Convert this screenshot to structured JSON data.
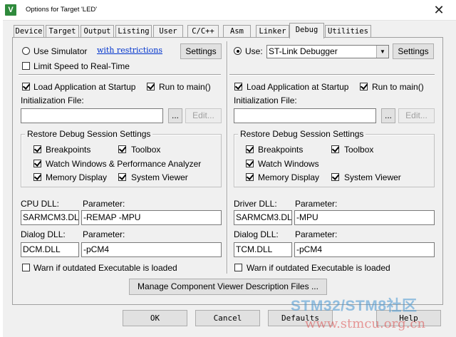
{
  "window": {
    "title": "Options for Target 'LED'",
    "icon": "V",
    "close_glyph": "✕"
  },
  "tabs": [
    {
      "label": "Device"
    },
    {
      "label": "Target"
    },
    {
      "label": "Output"
    },
    {
      "label": "Listing"
    },
    {
      "label": "User"
    },
    {
      "label": "C/C++"
    },
    {
      "label": "Asm"
    },
    {
      "label": "Linker"
    },
    {
      "label": "Debug",
      "active": true
    },
    {
      "label": "Utilities"
    }
  ],
  "left": {
    "use_simulator": "Use Simulator",
    "with_restrictions": "with restrictions",
    "settings": "Settings",
    "limit_speed": "Limit Speed to Real-Time",
    "load_app": "Load Application at Startup",
    "run_to_main": "Run to main()",
    "init_file_label": "Initialization File:",
    "browse": "...",
    "edit": "Edit...",
    "restore_title": "Restore Debug Session Settings",
    "breakpoints": "Breakpoints",
    "toolbox": "Toolbox",
    "watch": "Watch Windows & Performance Analyzer",
    "memory": "Memory Display",
    "system_viewer": "System Viewer",
    "cpu_dll_label": "CPU DLL:",
    "cpu_dll": "SARMCM3.DLL",
    "param_label": "Parameter:",
    "cpu_param": "-REMAP -MPU",
    "dialog_dll_label": "Dialog DLL:",
    "dialog_dll": "DCM.DLL",
    "dialog_param": "-pCM4",
    "warn": "Warn if outdated Executable is loaded"
  },
  "right": {
    "use": "Use:",
    "debugger": "ST-Link Debugger",
    "settings": "Settings",
    "load_app": "Load Application at Startup",
    "run_to_main": "Run to main()",
    "init_file_label": "Initialization File:",
    "browse": "...",
    "edit": "Edit...",
    "restore_title": "Restore Debug Session Settings",
    "breakpoints": "Breakpoints",
    "toolbox": "Toolbox",
    "watch": "Watch Windows",
    "memory": "Memory Display",
    "system_viewer": "System Viewer",
    "driver_dll_label": "Driver DLL:",
    "driver_dll": "SARMCM3.DLL",
    "param_label": "Parameter:",
    "driver_param": "-MPU",
    "dialog_dll_label": "Dialog DLL:",
    "dialog_dll": "TCM.DLL",
    "dialog_param": "-pCM4",
    "warn": "Warn if outdated Executable is loaded"
  },
  "manage_button": "Manage Component Viewer Description Files ...",
  "footer": {
    "ok": "OK",
    "cancel": "Cancel",
    "defaults": "Defaults",
    "help": "Help"
  },
  "watermark": {
    "line1": "STM32/STM8社区",
    "line2": "www.stmcu.org.cn"
  },
  "colors": {
    "link": "#0033cc",
    "icon_bg": "#2f8a3c"
  }
}
